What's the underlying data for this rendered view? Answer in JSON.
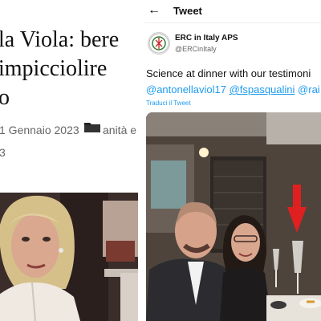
{
  "article": {
    "headline_line1": "la Viola: bere",
    "headline_line2": "impicciolire",
    "headline_line3": "o",
    "date": "1 Gennaio 2023",
    "category": "anità e",
    "meta_line2": "3",
    "folder_icon": "folder-icon"
  },
  "twitter": {
    "back_icon": "back-arrow-icon",
    "header_title": "Tweet",
    "account_name": "ERC in Italy APS",
    "account_handle": "@ERCinItaly",
    "text_line1": "Science at dinner with our testimoni",
    "mention1": "@antonellaviol17",
    "mention2": "@fspasqualini",
    "mention3": "@rai",
    "translate_label": "Traduci il Tweet"
  },
  "colors": {
    "link_blue": "#1d9bf0",
    "arrow_red": "#e02020"
  }
}
